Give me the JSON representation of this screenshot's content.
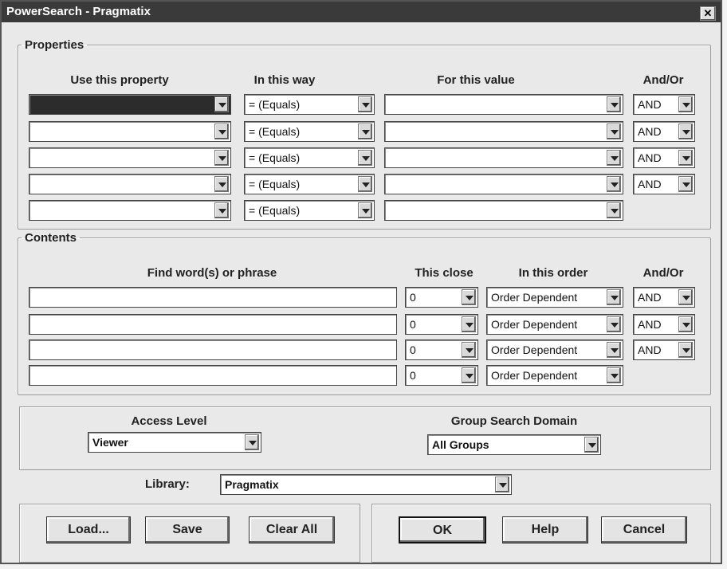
{
  "window": {
    "title": "PowerSearch - Pragmatix",
    "close_glyph": "✕"
  },
  "properties": {
    "legend": "Properties",
    "headers": {
      "property": "Use this property",
      "way": "In this way",
      "value": "For this value",
      "andor": "And/Or"
    },
    "rows": [
      {
        "property": "",
        "way": "= (Equals)",
        "value": "",
        "andor": "AND"
      },
      {
        "property": "",
        "way": "= (Equals)",
        "value": "",
        "andor": "AND"
      },
      {
        "property": "",
        "way": "= (Equals)",
        "value": "",
        "andor": "AND"
      },
      {
        "property": "",
        "way": "= (Equals)",
        "value": "",
        "andor": "AND"
      },
      {
        "property": "",
        "way": "= (Equals)",
        "value": "",
        "andor": ""
      }
    ]
  },
  "contents": {
    "legend": "Contents",
    "headers": {
      "phrase": "Find word(s) or phrase",
      "close": "This close",
      "order": "In this order",
      "andor": "And/Or"
    },
    "rows": [
      {
        "phrase": "",
        "close": "0",
        "order": "Order Dependent",
        "andor": "AND"
      },
      {
        "phrase": "",
        "close": "0",
        "order": "Order Dependent",
        "andor": "AND"
      },
      {
        "phrase": "",
        "close": "0",
        "order": "Order Dependent",
        "andor": "AND"
      },
      {
        "phrase": "",
        "close": "0",
        "order": "Order Dependent",
        "andor": ""
      }
    ]
  },
  "access": {
    "label": "Access Level",
    "value": "Viewer"
  },
  "group": {
    "label": "Group Search Domain",
    "value": "All Groups"
  },
  "library": {
    "label": "Library:",
    "value": "Pragmatix"
  },
  "buttons": {
    "load": "Load...",
    "save": "Save",
    "clear_all": "Clear All",
    "ok": "OK",
    "help": "Help",
    "cancel": "Cancel"
  }
}
